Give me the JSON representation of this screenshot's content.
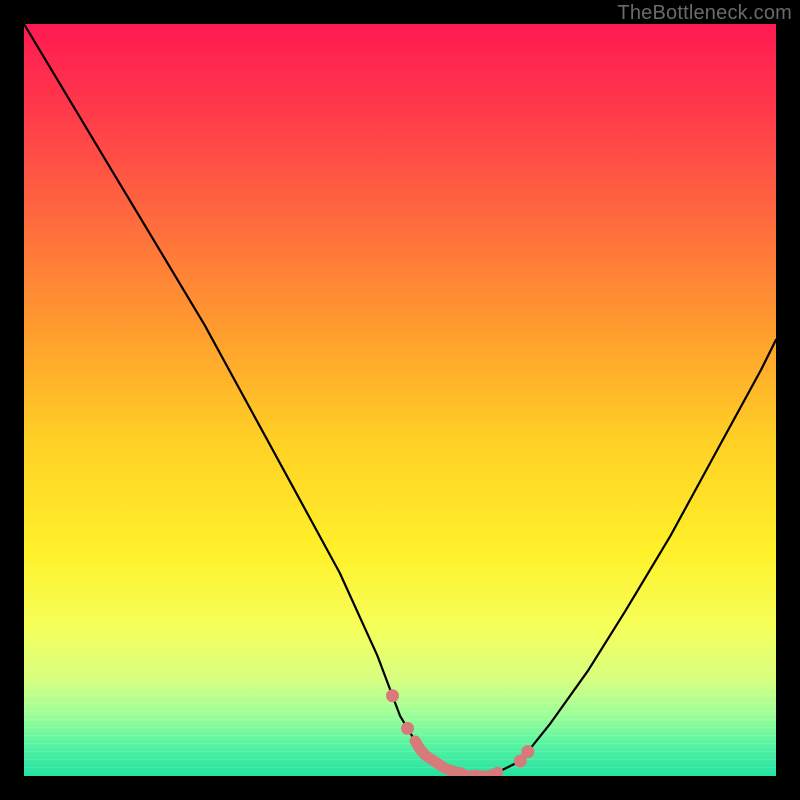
{
  "watermark": "TheBottleneck.com",
  "chart_data": {
    "type": "line",
    "title": "",
    "xlabel": "",
    "ylabel": "",
    "xlim": [
      0,
      100
    ],
    "ylim": [
      0,
      100
    ],
    "series": [
      {
        "name": "bottleneck-curve",
        "x": [
          0,
          6,
          12,
          18,
          24,
          30,
          36,
          42,
          47,
          50,
          53,
          56,
          59,
          62,
          66,
          70,
          75,
          80,
          86,
          92,
          98,
          100
        ],
        "values": [
          100,
          90,
          80,
          70,
          60,
          49,
          38,
          27,
          16,
          8,
          3,
          1,
          0,
          0,
          2,
          7,
          14,
          22,
          32,
          43,
          54,
          58
        ]
      }
    ],
    "markers": {
      "name": "trough-markers",
      "color": "#d77a7a",
      "x_range": [
        49,
        67
      ],
      "dots_x": [
        49,
        51,
        58,
        60,
        66,
        67
      ],
      "segment_x": [
        [
          52,
          63
        ]
      ]
    },
    "gradient_stops": [
      {
        "pos": 0,
        "color": "#ff1a52"
      },
      {
        "pos": 12,
        "color": "#ff3b4a"
      },
      {
        "pos": 26,
        "color": "#ff6a3e"
      },
      {
        "pos": 40,
        "color": "#ff9a2f"
      },
      {
        "pos": 55,
        "color": "#ffcf25"
      },
      {
        "pos": 70,
        "color": "#fff029"
      },
      {
        "pos": 80,
        "color": "#f6ff59"
      },
      {
        "pos": 87,
        "color": "#d8ff80"
      },
      {
        "pos": 92,
        "color": "#9cff99"
      },
      {
        "pos": 96,
        "color": "#55f3a3"
      },
      {
        "pos": 100,
        "color": "#23e2a0"
      }
    ]
  }
}
